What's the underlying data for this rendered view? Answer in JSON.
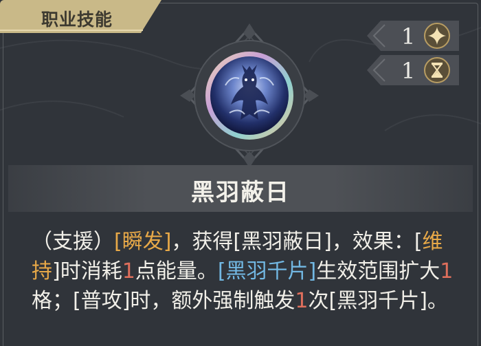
{
  "tab": {
    "label": "职业技能"
  },
  "badges": [
    {
      "value": "1",
      "icon": "sparkle-icon"
    },
    {
      "value": "1",
      "icon": "hourglass-icon"
    }
  ],
  "skill": {
    "name": "黑羽蔽日",
    "description": [
      {
        "text": "（支援）",
        "style": "plain"
      },
      {
        "text": "[瞬发]",
        "style": "gold"
      },
      {
        "text": "，获得[黑羽蔽日]，效果：[",
        "style": "plain"
      },
      {
        "text": "维持",
        "style": "gold"
      },
      {
        "text": "]时消耗",
        "style": "plain"
      },
      {
        "text": "1",
        "style": "red"
      },
      {
        "text": "点能量。",
        "style": "plain"
      },
      {
        "text": "[黑羽千片]",
        "style": "blue"
      },
      {
        "text": "生效范围扩大",
        "style": "plain"
      },
      {
        "text": "1",
        "style": "red"
      },
      {
        "text": "格；[普攻]时，额外强制触发",
        "style": "plain"
      },
      {
        "text": "1",
        "style": "red"
      },
      {
        "text": "次[黑羽千片]。",
        "style": "plain"
      }
    ]
  },
  "colors": {
    "gold_keyword": "#e8a948",
    "blue_keyword": "#72b8e3",
    "red_number": "#e06f5c",
    "tab_gold": "#c9b988"
  }
}
